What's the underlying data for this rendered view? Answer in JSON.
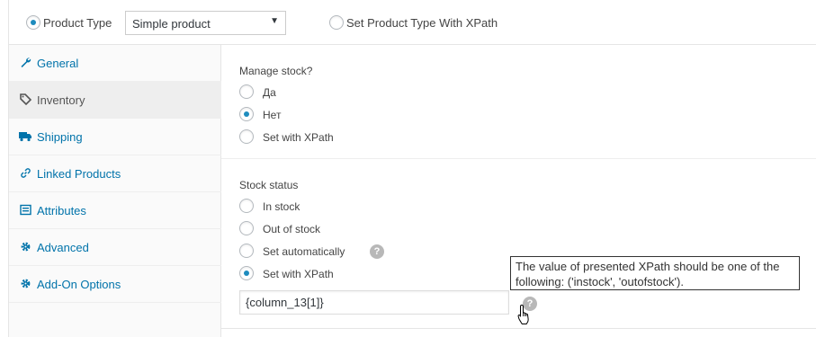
{
  "topbar": {
    "product_type_label": "Product Type",
    "product_type_selected": "Simple product",
    "xpath_option_label": "Set Product Type With XPath"
  },
  "sidebar": {
    "items": [
      {
        "label": "General",
        "icon": "wrench-icon",
        "active": false
      },
      {
        "label": "Inventory",
        "icon": "tag-icon",
        "active": true
      },
      {
        "label": "Shipping",
        "icon": "truck-icon",
        "active": false
      },
      {
        "label": "Linked Products",
        "icon": "link-icon",
        "active": false
      },
      {
        "label": "Attributes",
        "icon": "list-icon",
        "active": false
      },
      {
        "label": "Advanced",
        "icon": "gear-icon",
        "active": false
      },
      {
        "label": "Add-On Options",
        "icon": "gear-icon",
        "active": false
      }
    ]
  },
  "manage_stock": {
    "title": "Manage stock?",
    "options": [
      "Да",
      "Нет",
      "Set with XPath"
    ],
    "selected": "Нет"
  },
  "stock_status": {
    "title": "Stock status",
    "options": [
      "In stock",
      "Out of stock",
      "Set automatically",
      "Set with XPath"
    ],
    "selected": "Set with XPath",
    "xpath_value": "{column_13[1]}"
  },
  "tooltip": {
    "text": "The value of presented XPath should be one of the following: ('instock', 'outofstock')."
  },
  "colors": {
    "link": "#0073aa",
    "radio_checked": "#1e8cbe",
    "border": "#e5e5e5"
  }
}
